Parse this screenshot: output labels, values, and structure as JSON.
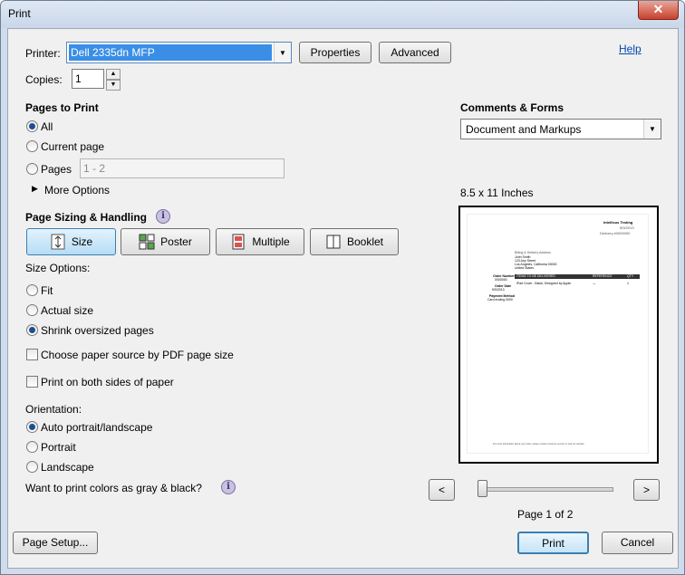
{
  "window": {
    "title": "Print",
    "close_symbol": "✕"
  },
  "help_label": "Help",
  "printer": {
    "label": "Printer:",
    "value": "Dell 2335dn MFP",
    "properties": "Properties",
    "advanced": "Advanced"
  },
  "copies": {
    "label": "Copies:",
    "value": "1"
  },
  "pages_to_print": {
    "heading": "Pages to Print",
    "all": "All",
    "current": "Current page",
    "pages": "Pages",
    "range_placeholder": "1 - 2",
    "more_options": "More Options",
    "selected": "all"
  },
  "comments_forms": {
    "heading": "Comments & Forms",
    "value": "Document and Markups"
  },
  "paper_size": "8.5 x 11 Inches",
  "sizing": {
    "heading": "Page Sizing & Handling",
    "size": "Size",
    "poster": "Poster",
    "multiple": "Multiple",
    "booklet": "Booklet",
    "active": "size"
  },
  "size_options": {
    "label": "Size Options:",
    "fit": "Fit",
    "actual": "Actual size",
    "shrink": "Shrink oversized pages",
    "selected": "shrink"
  },
  "paper_source": "Choose paper source by PDF page size",
  "both_sides": "Print on both sides of paper",
  "orientation": {
    "label": "Orientation:",
    "auto": "Auto portrait/landscape",
    "portrait": "Portrait",
    "landscape": "Landscape",
    "selected": "auto"
  },
  "gray_question": "Want to print colors as gray & black?",
  "nav": {
    "prev": "<",
    "next": ">",
    "page_indicator": "Page 1 of 2",
    "slider_fraction": 0
  },
  "buttons": {
    "page_setup": "Page Setup...",
    "print": "Print",
    "cancel": "Cancel"
  },
  "preview": {
    "header_company": "Intellicus Testing",
    "header_date": "5/9/2013",
    "header_delivery": "Delivery #0000000",
    "address_title": "Billing & Delivery Address",
    "address_lines": [
      "John Smith",
      "123 Any Street",
      "Los Angeles, California 00000",
      "United States"
    ],
    "order_number_label": "Order Number",
    "order_number_value": "0000000",
    "order_date_label": "Order Date",
    "order_date_value": "5/9/2013",
    "table_header": [
      "ITEMS TO BE DELIVERED",
      "REFERENCE",
      "QTY"
    ],
    "table_row": [
      "iPad Cover - Black, Designed by Apple",
      "—",
      "1"
    ],
    "payment_label": "Payment Method",
    "payment_value": "Card ending 0000",
    "footer_text": "For more information about your order, please contact customer service or visit our website."
  }
}
